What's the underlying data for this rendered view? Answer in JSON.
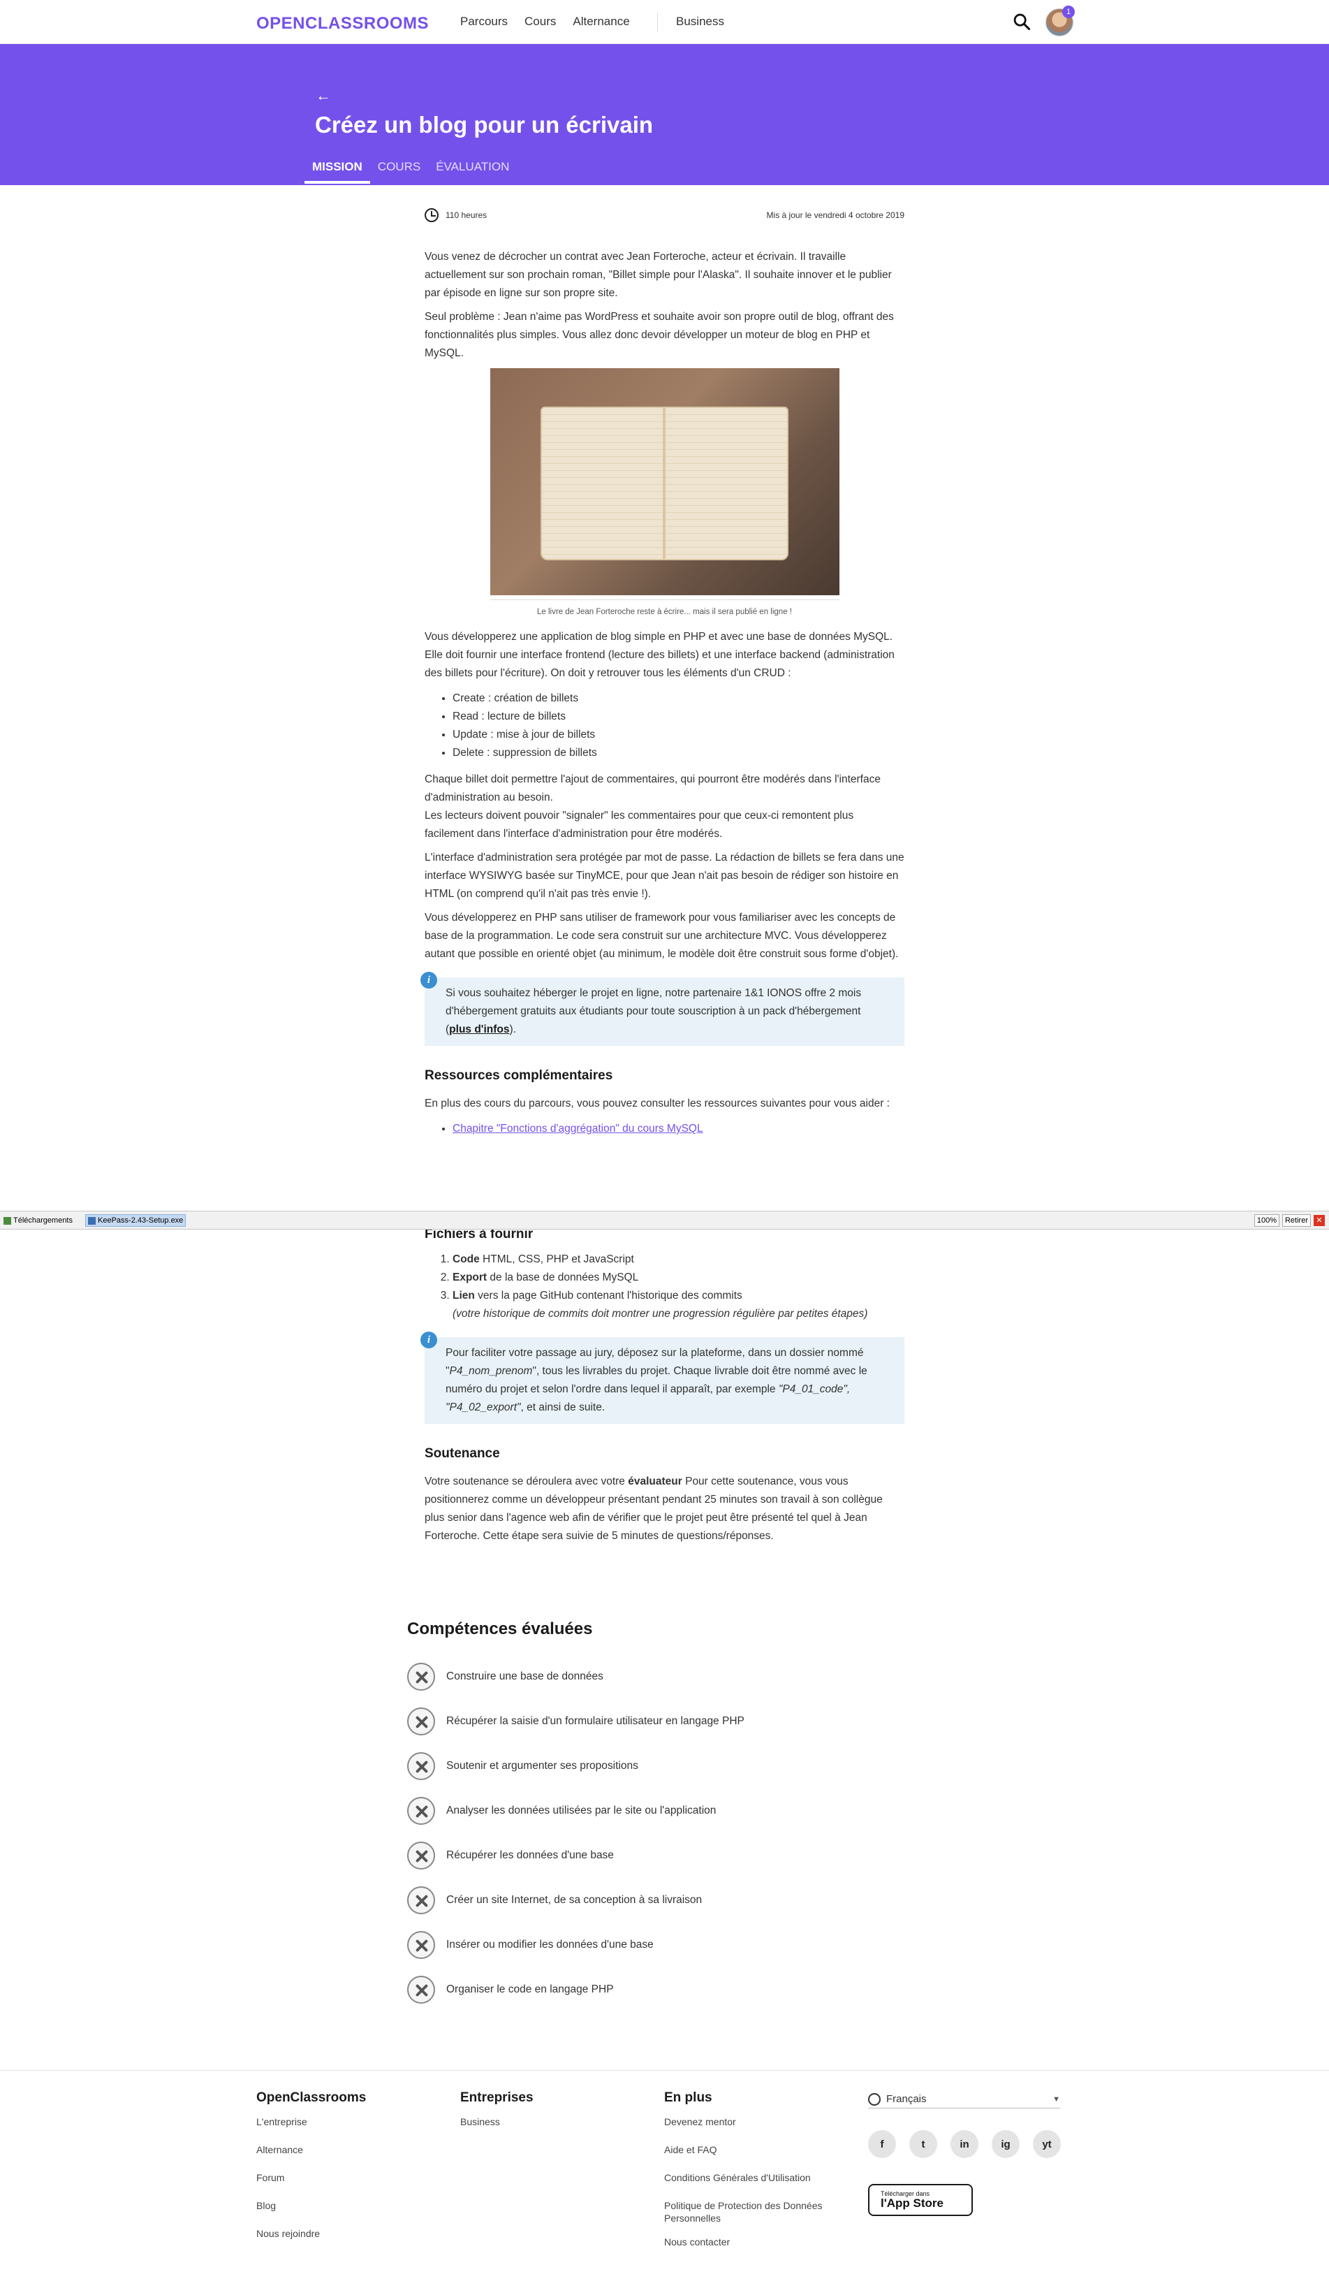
{
  "header": {
    "logo": "OPENCLASSROOMS",
    "nav": [
      "Parcours",
      "Cours",
      "Alternance"
    ],
    "business": "Business",
    "notif_count": "1"
  },
  "hero": {
    "title": "Créez un blog pour un écrivain",
    "tabs": [
      "MISSION",
      "COURS",
      "ÉVALUATION"
    ]
  },
  "meta": {
    "duration": "110 heures",
    "updated": "Mis à jour le vendredi 4 octobre 2019"
  },
  "mission": {
    "p1": "Vous venez de décrocher un contrat avec Jean Forteroche, acteur et écrivain. Il travaille actuellement sur son prochain roman, \"Billet simple pour l'Alaska\". Il souhaite innover et le publier par épisode en ligne sur son propre site.",
    "p2": "Seul problème : Jean n'aime pas WordPress et souhaite avoir son propre outil de blog, offrant des fonctionnalités plus simples. Vous allez donc devoir développer un moteur de blog en PHP et MySQL.",
    "caption": "Le livre de Jean Forteroche reste à écrire... mais il sera publié en ligne !",
    "p3": "Vous développerez une application de blog simple en PHP et avec une base de données MySQL. Elle doit fournir une interface frontend (lecture des billets) et une interface backend (administration des billets pour l'écriture). On doit y retrouver tous les éléments d'un CRUD :",
    "crud": [
      "Create : création de billets",
      "Read : lecture de billets",
      "Update : mise à jour de billets",
      "Delete : suppression de billets"
    ],
    "p4a": "Chaque billet doit permettre l'ajout de commentaires, qui pourront être modérés dans l'interface d'administration au besoin.",
    "p4b": "Les lecteurs doivent pouvoir \"signaler\" les commentaires pour que ceux-ci remontent plus facilement dans l'interface d'administration pour être modérés.",
    "p5": "L'interface d'administration sera protégée par mot de passe. La rédaction de billets se fera dans une interface WYSIWYG basée sur TinyMCE, pour que Jean n'ait pas besoin de rédiger son histoire en HTML (on comprend qu'il n'ait pas très envie !).",
    "p6": "Vous développerez en PHP sans utiliser de framework pour vous familiariser avec les concepts de base de la programmation. Le code sera construit sur une architecture MVC. Vous développerez autant que possible en orienté objet (au minimum, le modèle doit être construit sous forme d'objet).",
    "info1_text": "Si vous souhaitez héberger le projet en ligne, notre partenaire 1&1 IONOS offre 2 mois d'hébergement gratuits aux étudiants pour toute souscription à un pack d'hébergement (",
    "info1_link": "plus d'infos",
    "info1_end": ").",
    "res_title": "Ressources complémentaires",
    "res_text": "En plus des cours du parcours, vous pouvez consulter les ressources suivantes pour vous aider :",
    "res_link": "Chapitre \"Fonctions d'aggrégation\" du cours MySQL"
  },
  "downloads": {
    "label": "Téléchargements",
    "file": "KeePass-2.43-Setup.exe",
    "zoom": "100%",
    "retract": "Retirer"
  },
  "deliverables": {
    "title": "Fichiers à fournir",
    "items": [
      {
        "bold": "Code",
        "text": " HTML, CSS, PHP et JavaScript"
      },
      {
        "bold": "Export",
        "text": " de la base de données MySQL"
      },
      {
        "bold": "Lien",
        "text": " vers la page GitHub contenant l'historique des commits"
      }
    ],
    "note": "(votre historique de commits doit montrer une progression régulière par petites étapes)",
    "info2_a": "Pour faciliter votre passage au jury, déposez sur la plateforme, dans un dossier nommé \"",
    "info2_name": "P4_nom_prenom",
    "info2_b": "\", tous les livrables du projet. Chaque livrable doit être nommé avec le numéro du projet et selon l'ordre dans lequel il apparaît, par exemple ",
    "info2_ex": "\"P4_01_code\", \"P4_02_export\"",
    "info2_c": ", et ainsi de suite."
  },
  "defense": {
    "title": "Soutenance",
    "a": "Votre soutenance se déroulera avec votre ",
    "bold": "évaluateur",
    "b": " Pour cette soutenance, vous vous positionnerez comme un développeur présentant pendant 25 minutes son travail à son collègue plus senior dans l'agence web afin de vérifier que le projet peut être présenté tel quel à Jean Forteroche. Cette étape sera suivie de 5 minutes de questions/réponses."
  },
  "skills": {
    "title": "Compétences évaluées",
    "items": [
      "Construire une base de données",
      "Récupérer la saisie d'un formulaire utilisateur en langage PHP",
      "Soutenir et argumenter ses propositions",
      "Analyser les données utilisées par le site ou l'application",
      "Récupérer les données d'une base",
      "Créer un site Internet, de sa conception à sa livraison",
      "Insérer ou modifier les données d'une base",
      "Organiser le code en langage PHP"
    ]
  },
  "footer": {
    "col1": {
      "title": "OpenClassrooms",
      "links": [
        "L'entreprise",
        "Alternance",
        "Forum",
        "Blog",
        "Nous rejoindre"
      ]
    },
    "col2": {
      "title": "Entreprises",
      "links": [
        "Business"
      ]
    },
    "col3": {
      "title": "En plus",
      "links": [
        "Devenez mentor",
        "Aide et FAQ",
        "Conditions Générales d'Utilisation",
        "Politique de Protection des Données Personnelles",
        "Nous contacter"
      ]
    },
    "language": "Français",
    "socials": [
      "f",
      "t",
      "in",
      "ig",
      "yt"
    ],
    "appstore_small": "Télécharger dans",
    "appstore_big": "l'App Store"
  }
}
